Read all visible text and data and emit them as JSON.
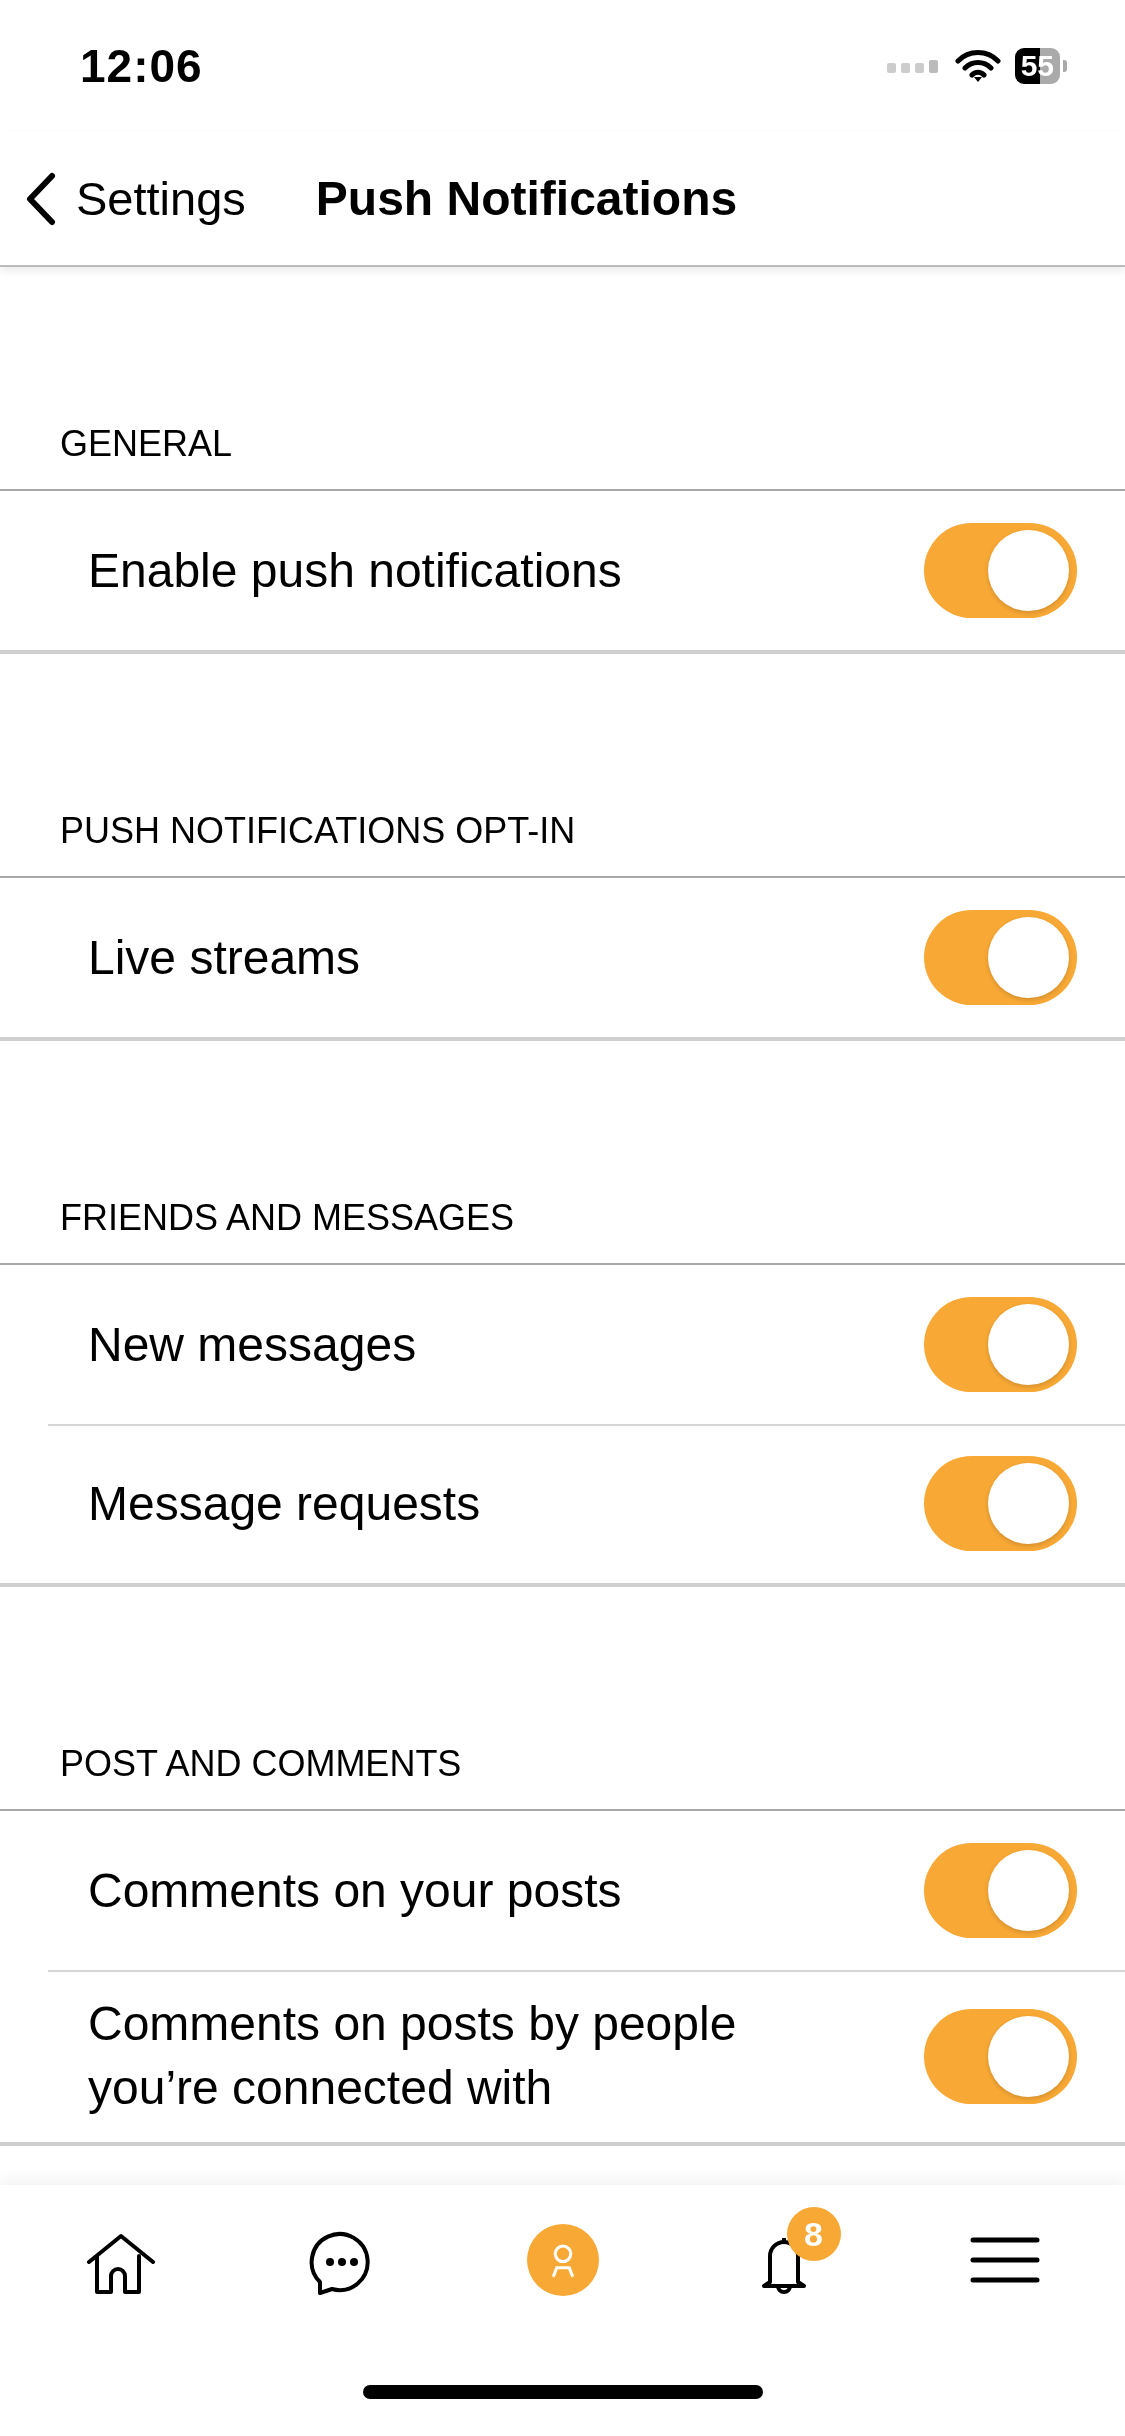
{
  "status_bar": {
    "time": "12:06",
    "battery": "55"
  },
  "nav": {
    "back_label": "Settings",
    "title": "Push Notifications"
  },
  "sections": [
    {
      "header": "GENERAL",
      "rows": [
        {
          "label": "Enable push notifications",
          "on": true
        }
      ]
    },
    {
      "header": "PUSH NOTIFICATIONS OPT-IN",
      "rows": [
        {
          "label": "Live streams",
          "on": true
        }
      ]
    },
    {
      "header": "FRIENDS AND MESSAGES",
      "rows": [
        {
          "label": "New messages",
          "on": true
        },
        {
          "label": "Message requests",
          "on": true
        }
      ]
    },
    {
      "header": "POST AND COMMENTS",
      "rows": [
        {
          "label": "Comments on your posts",
          "on": true
        },
        {
          "label": "Comments on posts by people you’re connected with",
          "on": true
        }
      ]
    }
  ],
  "tab_bar": {
    "items": [
      {
        "kind": "home",
        "selected": false
      },
      {
        "kind": "chat",
        "selected": false
      },
      {
        "kind": "profile",
        "selected": true
      },
      {
        "kind": "bell",
        "selected": false,
        "badge": "8"
      },
      {
        "kind": "menu",
        "selected": false
      }
    ]
  }
}
